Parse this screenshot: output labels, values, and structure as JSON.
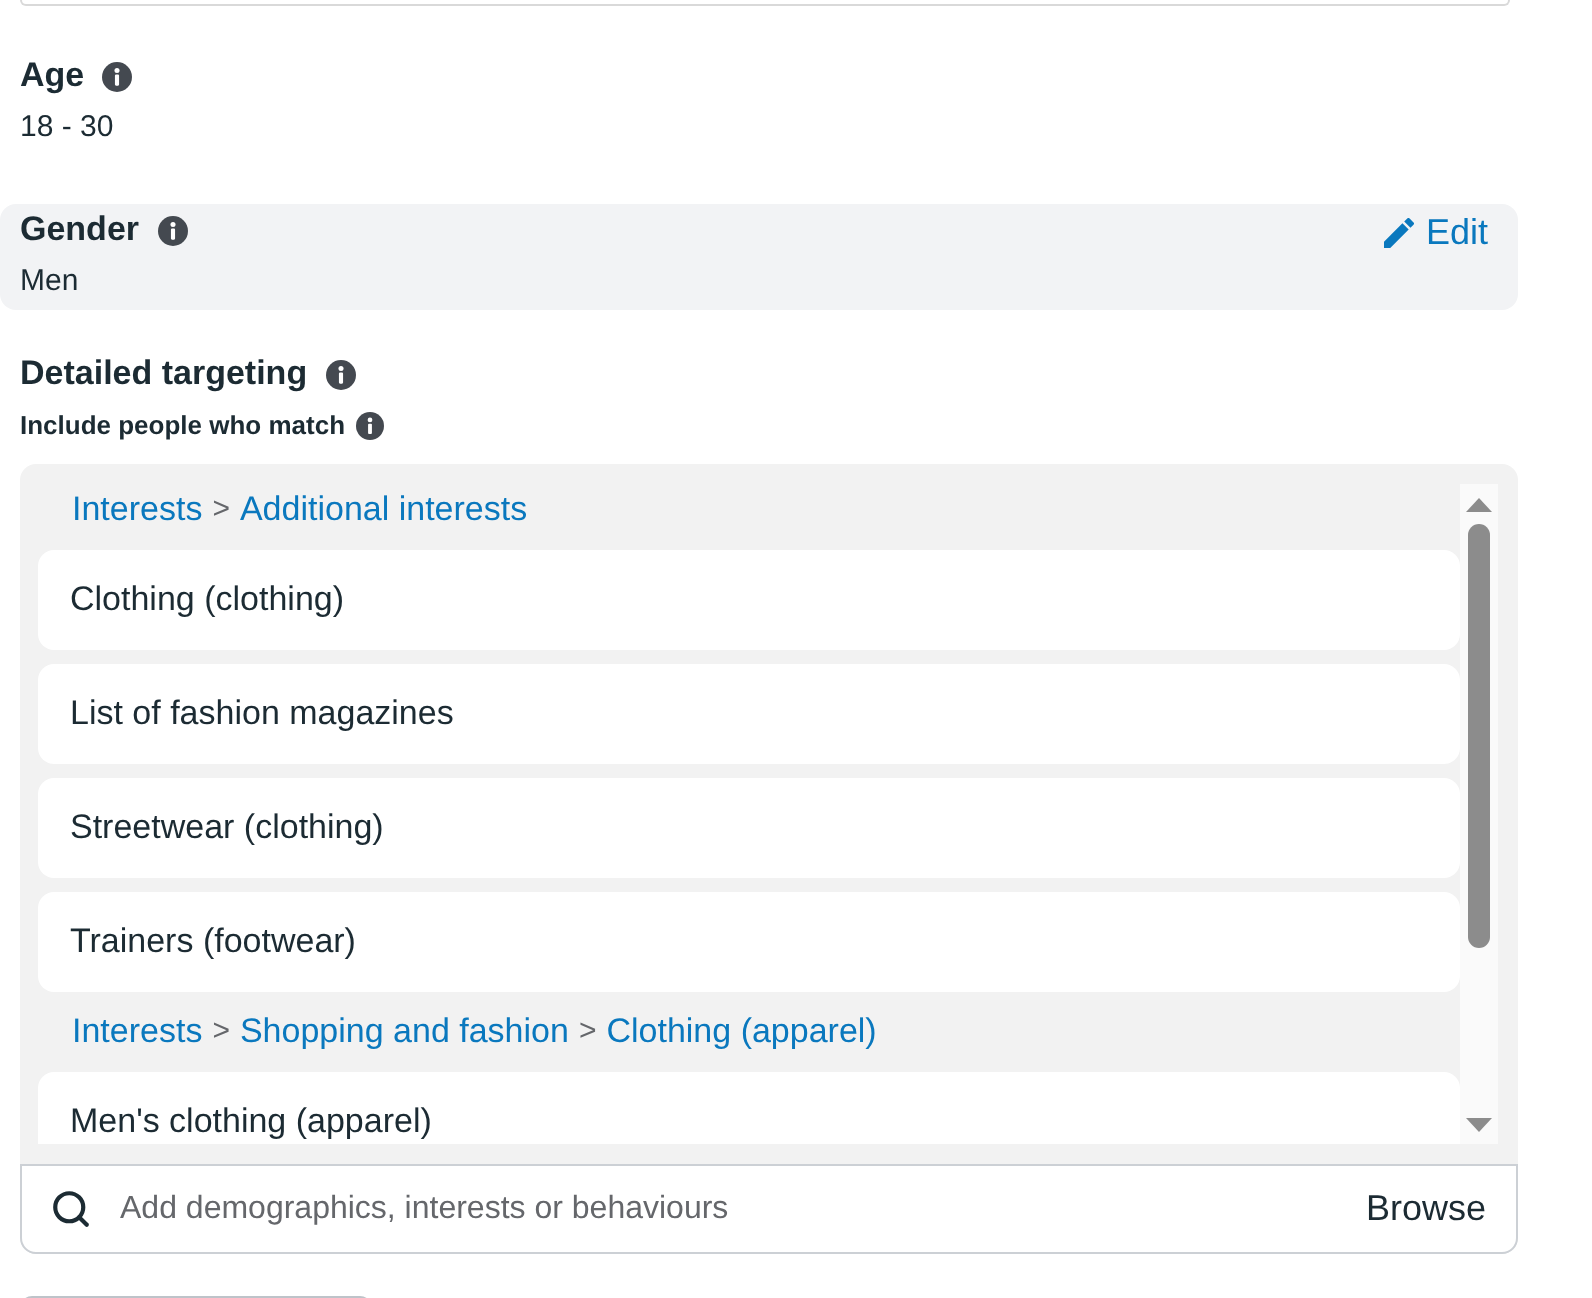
{
  "sections": [
    {
      "label": "Age",
      "value": "18 - 30",
      "highlighted": false
    },
    {
      "label": "Gender",
      "value": "Men",
      "highlighted": true,
      "edit_label": "Edit"
    }
  ],
  "detailed_targeting": {
    "label": "Detailed targeting",
    "sublabel": "Include people who match",
    "groups": [
      {
        "breadcrumb": [
          {
            "kind": "link",
            "text": "Interests"
          },
          {
            "kind": "separator",
            "text": ">"
          },
          {
            "kind": "link",
            "text": "Additional interests"
          }
        ],
        "items": [
          "Clothing (clothing)",
          "List of fashion magazines",
          "Streetwear (clothing)",
          "Trainers (footwear)"
        ]
      },
      {
        "breadcrumb": [
          {
            "kind": "link",
            "text": "Interests"
          },
          {
            "kind": "separator",
            "text": ">"
          },
          {
            "kind": "link",
            "text": "Shopping and fashion"
          },
          {
            "kind": "separator",
            "text": ">"
          },
          {
            "kind": "link",
            "text": "Clothing (apparel)"
          }
        ],
        "items": [
          "Men's clothing (apparel)"
        ]
      }
    ],
    "search": {
      "placeholder": "Add demographics, interests or behaviours",
      "browse_label": "Browse"
    }
  }
}
